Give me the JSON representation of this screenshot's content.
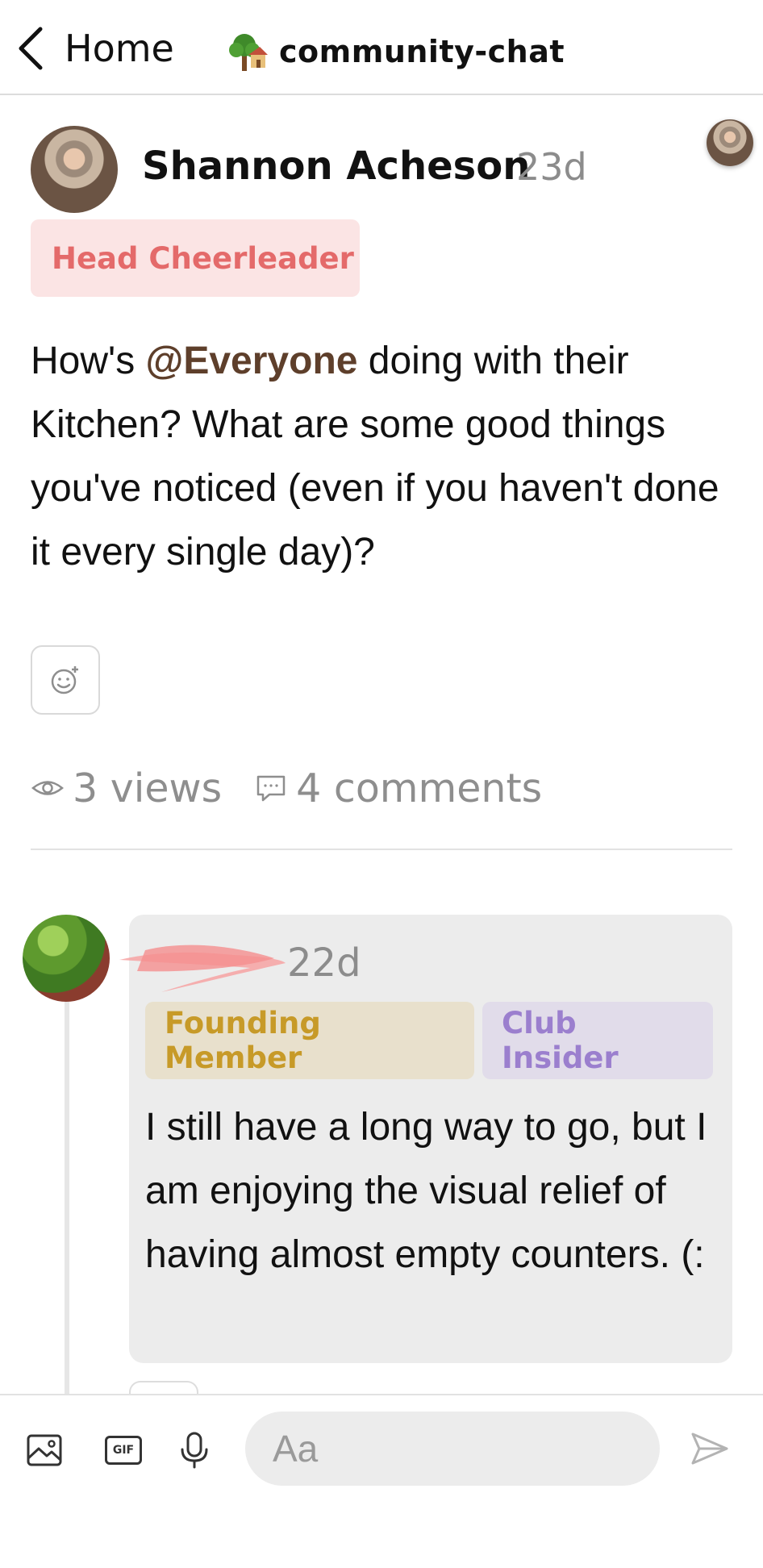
{
  "header": {
    "back_label": "Home",
    "channel_name": "community-chat",
    "channel_icon": "tree-house-emoji"
  },
  "post": {
    "author_name": "Shannon Acheson",
    "time_ago": "23d",
    "role_badge": "Head Cheerleader",
    "body_before_mention": "How's ",
    "mention": "@Everyone",
    "body_after_mention": " doing with their Kitchen? What are some good things you've noticed (even if you haven't done it every single day)?",
    "views": "3 views",
    "comments": "4 comments"
  },
  "comment": {
    "author_name": "",
    "time_ago": "22d",
    "badges": [
      "Founding Member",
      "Club Insider"
    ],
    "body": "I still have a long way to go, but I am enjoying the visual relief of having almost empty counters.  (:"
  },
  "composer": {
    "placeholder": "Aa"
  },
  "colors": {
    "role_badge_bg": "#fbe4e4",
    "role_badge_text": "#e46a6a",
    "founding_bg": "#e8e0cc",
    "founding_text": "#c79a28",
    "insider_bg": "#e1dcea",
    "insider_text": "#9b7fce",
    "mention": "#5e3f2b",
    "muted": "#8c8c8c"
  }
}
